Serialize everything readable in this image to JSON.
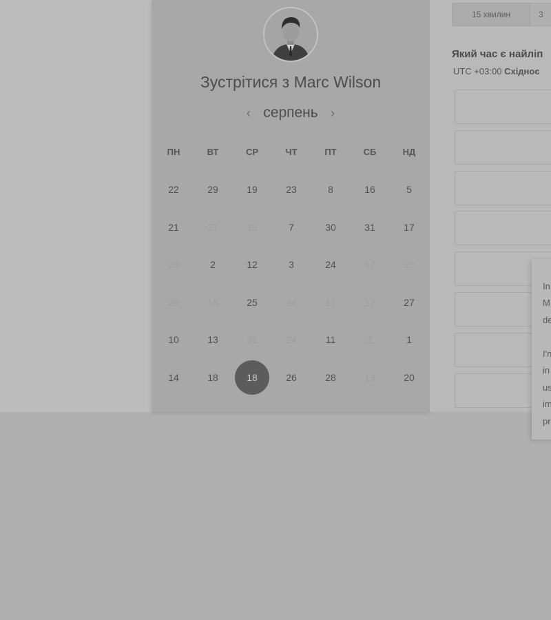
{
  "header": {
    "title_prefix": "Зустрітися з",
    "host_name": "Marc Wilson"
  },
  "calendar": {
    "month": "серпень",
    "prev_arrow": "‹",
    "next_arrow": "›",
    "weekdays": [
      "ПН",
      "ВТ",
      "СР",
      "ЧТ",
      "ПТ",
      "СБ",
      "НД"
    ],
    "weeks": [
      [
        {
          "d": "22"
        },
        {
          "d": "29"
        },
        {
          "d": "19"
        },
        {
          "d": "23"
        },
        {
          "d": "8"
        },
        {
          "d": "16"
        },
        {
          "d": "5"
        }
      ],
      [
        {
          "d": "21"
        },
        {
          "d": "27",
          "dim": true
        },
        {
          "d": "19",
          "dim": true
        },
        {
          "d": "7"
        },
        {
          "d": "30"
        },
        {
          "d": "31"
        },
        {
          "d": "17"
        }
      ],
      [
        {
          "d": "20",
          "dim": true
        },
        {
          "d": "2"
        },
        {
          "d": "12"
        },
        {
          "d": "3"
        },
        {
          "d": "24"
        },
        {
          "d": "17",
          "dim": true
        },
        {
          "d": "22",
          "dim": true
        }
      ],
      [
        {
          "d": "28",
          "dim": true
        },
        {
          "d": "18",
          "dim": true
        },
        {
          "d": "25"
        },
        {
          "d": "14",
          "dim": true
        },
        {
          "d": "17",
          "dim": true
        },
        {
          "d": "17",
          "dim": true
        },
        {
          "d": "27"
        }
      ],
      [
        {
          "d": "10"
        },
        {
          "d": "13"
        },
        {
          "d": "31",
          "dim": true
        },
        {
          "d": "24",
          "dim": true
        },
        {
          "d": "11"
        },
        {
          "d": "2",
          "dim": true
        },
        {
          "d": "1"
        }
      ],
      [
        {
          "d": "14"
        },
        {
          "d": "18"
        },
        {
          "d": "18",
          "selected": true
        },
        {
          "d": "26"
        },
        {
          "d": "28"
        },
        {
          "d": "13",
          "dim": true
        },
        {
          "d": "20"
        }
      ]
    ]
  },
  "durations": {
    "tab_1": "15 хвилин",
    "tab_2": "3"
  },
  "time_picker": {
    "question": "Який час є найліп",
    "timezone_offset": "UTC +03:00",
    "timezone_name": "Східноє",
    "slot_count": 8
  },
  "popup": {
    "lines": [
      "In",
      "M",
      "de",
      "",
      "I'n",
      "in",
      "us",
      "im",
      "pr"
    ]
  },
  "colors": {
    "selected_day": "#5c5c5c",
    "overlay": "#bcbcbc"
  }
}
